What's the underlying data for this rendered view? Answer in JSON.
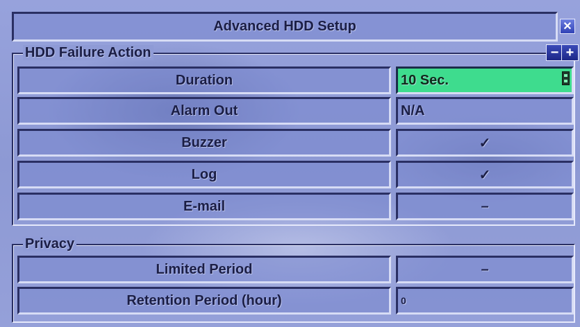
{
  "window": {
    "title": "Advanced HDD Setup",
    "close_icon": "close-icon"
  },
  "hdd_failure": {
    "legend": "HDD Failure Action",
    "minus_label": "−",
    "plus_label": "+",
    "rows": [
      {
        "label": "Duration",
        "value": "10 Sec."
      },
      {
        "label": "Alarm Out",
        "value": "N/A"
      },
      {
        "label": "Buzzer",
        "value": "✓"
      },
      {
        "label": "Log",
        "value": "✓"
      },
      {
        "label": "E-mail",
        "value": "–"
      }
    ]
  },
  "privacy": {
    "legend": "Privacy",
    "rows": [
      {
        "label": "Limited Period",
        "value": "–"
      },
      {
        "label": "Retention Period (hour)",
        "value": "0"
      }
    ]
  },
  "colors": {
    "accent_selected": "#3edc8e",
    "panel_dark": "#2a2f63",
    "text": "#1b1e45"
  }
}
